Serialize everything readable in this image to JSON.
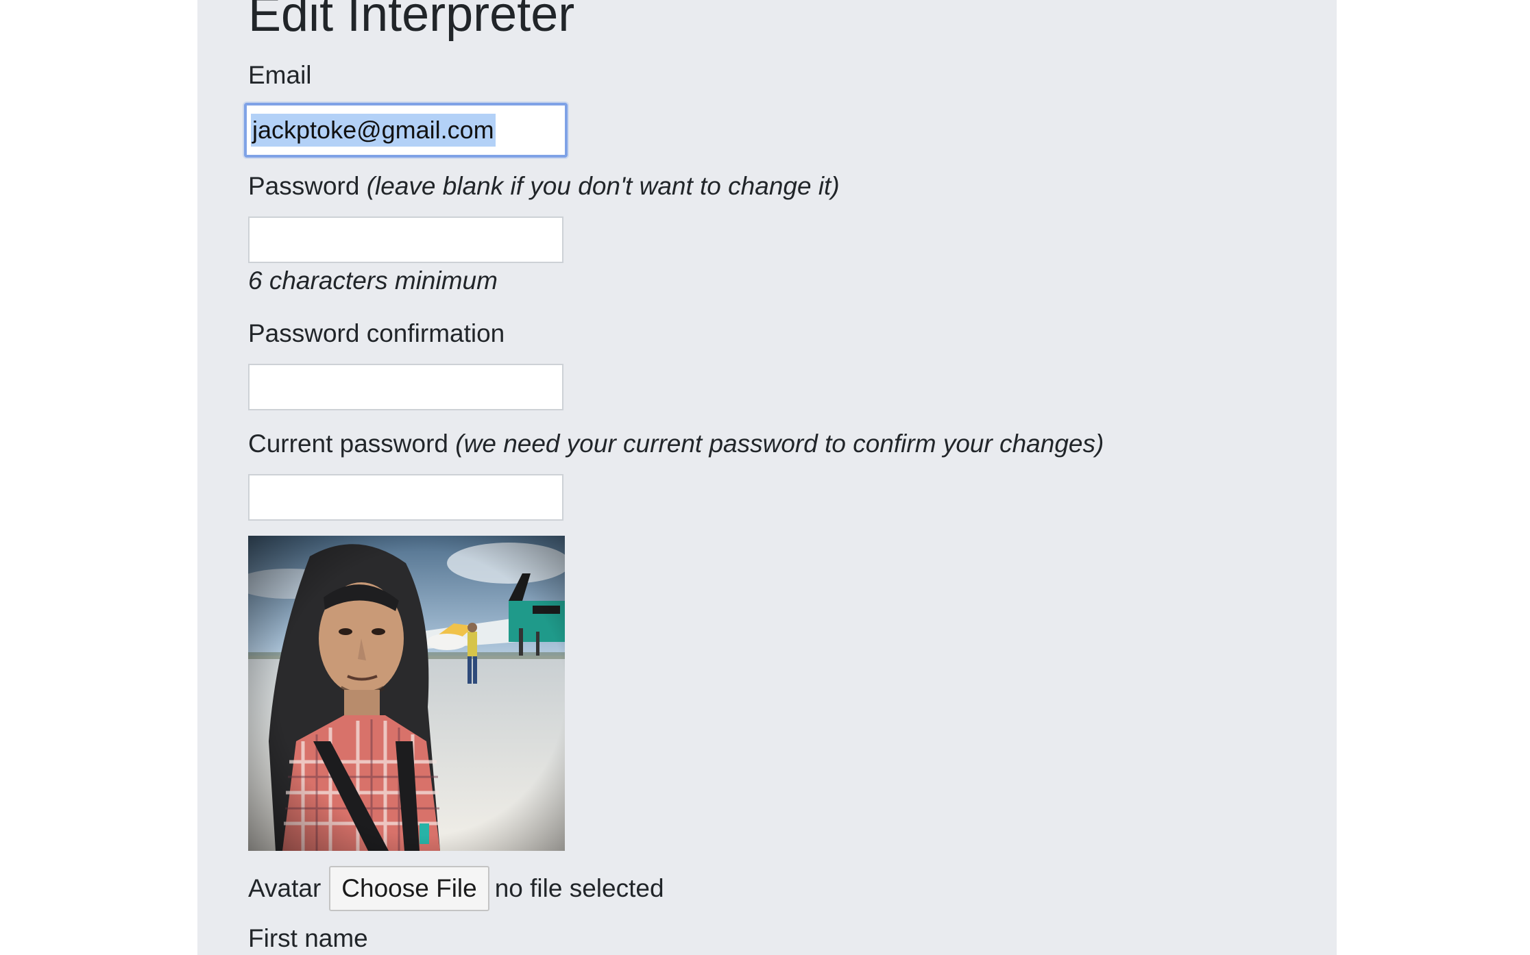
{
  "page": {
    "title": "Edit Interpreter"
  },
  "form": {
    "email": {
      "label": "Email",
      "value": "jackptoke@gmail.com"
    },
    "password": {
      "label": "Password",
      "note": "(leave blank if you don't want to change it)",
      "value": "",
      "hint": "6 characters minimum"
    },
    "password_confirmation": {
      "label": "Password confirmation",
      "value": ""
    },
    "current_password": {
      "label": "Current password",
      "note": "(we need your current password to confirm your changes)",
      "value": ""
    },
    "avatar": {
      "label": "Avatar",
      "button_label": "Choose File",
      "status": "no file selected"
    },
    "first_name": {
      "label": "First name"
    }
  },
  "colors": {
    "panel_background": "#e9ebef",
    "focus_ring": "#7fa2e6",
    "selection": "#b3d1f7"
  }
}
